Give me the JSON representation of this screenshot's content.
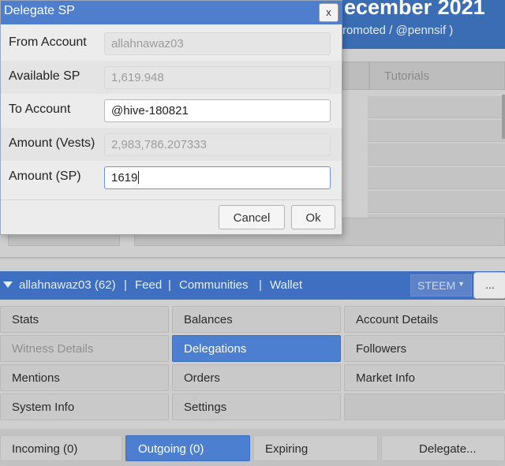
{
  "background": {
    "title": "ecember 2021",
    "subtitle": "romoted / @pennsif )",
    "tab_tutorials": "Tutorials"
  },
  "dialog": {
    "title": "Delegate SP",
    "close_label": "x",
    "fields": [
      {
        "label": "From Account",
        "value": "allahnawaz03",
        "editable": false
      },
      {
        "label": "Available SP",
        "value": "1,619.948",
        "editable": false
      },
      {
        "label": "To Account",
        "value": "@hive-180821",
        "editable": true
      },
      {
        "label": "Amount (Vests)",
        "value": "2,983,786.207333",
        "editable": false
      },
      {
        "label": "Amount (SP)",
        "value": "1619",
        "editable": true
      }
    ],
    "cancel_label": "Cancel",
    "ok_label": "Ok"
  },
  "nav": {
    "account": "allahnawaz03 (62)",
    "feed": "Feed",
    "communities": "Communities",
    "wallet": "Wallet",
    "separator": "|",
    "chain_selected": "STEEM",
    "more_label": "..."
  },
  "menu": {
    "stats": "Stats",
    "balances": "Balances",
    "account_details": "Account Details",
    "witness_details": "Witness Details",
    "delegations": "Delegations",
    "followers": "Followers",
    "mentions": "Mentions",
    "orders": "Orders",
    "market_info": "Market Info",
    "system_info": "System Info",
    "settings": "Settings"
  },
  "delegation_tabs": {
    "incoming": "Incoming (0)",
    "outgoing": "Outgoing (0)",
    "expiring": "Expiring",
    "delegate": "Delegate..."
  },
  "colors": {
    "accent": "#4d7fd0",
    "nav_bar": "#3f6fc1",
    "dialog_title": "#4f7fcc"
  }
}
